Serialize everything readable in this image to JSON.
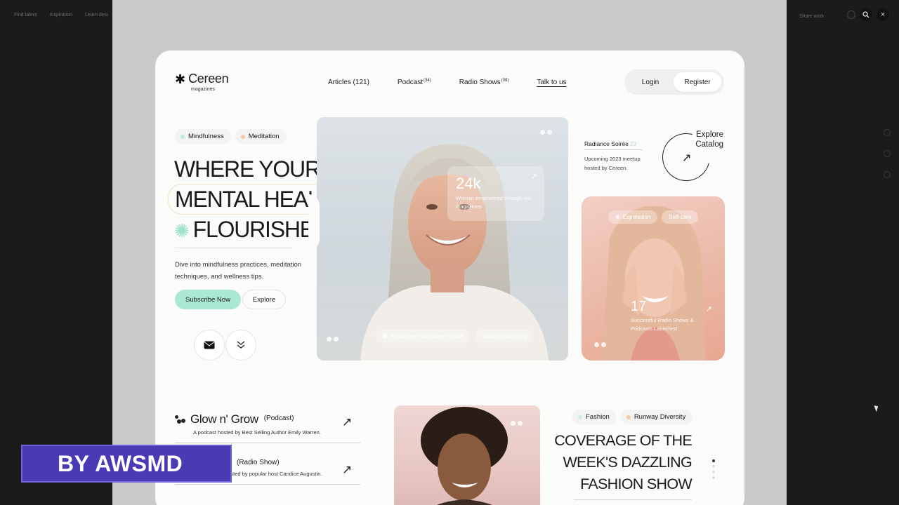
{
  "viewer": {
    "nav": [
      "Find talent",
      "Inspiration",
      "Learn desi"
    ],
    "share_label": "Share work",
    "zoom_icon": "search-icon",
    "close_glyph": "×"
  },
  "site": {
    "brand": "Cereen",
    "brand_sub": "magazines",
    "nav": {
      "articles": "Articles (121)",
      "podcast": "Podcast",
      "podcast_count": "(34)",
      "radio": "Radio Shows",
      "radio_count": "(09)",
      "talk": "Talk to us"
    },
    "login": "Login",
    "register": "Register"
  },
  "hero": {
    "tags": [
      {
        "label": "Mindfulness",
        "color": "#bfe9da"
      },
      {
        "label": "Meditation",
        "color": "#f4c9a9"
      }
    ],
    "headline": [
      "WHERE YOUR",
      "MENTAL HEALTH",
      "FLOURISHES"
    ],
    "description": "Dive into mindfulness practices, meditation techniques, and wellness tips.",
    "subscribe": "Subscribe Now",
    "explore": "Explore",
    "stat_value": "24k",
    "stat_caption": "Woman empowered through our magazines",
    "pills": [
      "Rediscover Your Inner Peace",
      "holistic well-being"
    ]
  },
  "event": {
    "title": "Radiance Soirée",
    "year": "23",
    "description": "Upcoming 2023 meetup hosted by Cereen.",
    "explore_catalog": "Explore Catalog"
  },
  "side_card": {
    "pills": [
      "Expression",
      "Self-care"
    ],
    "stat_value": "17",
    "stat_caption": "Successful Radio Shows & Podcasts Launched"
  },
  "shows": [
    {
      "title": "Glow n' Grow",
      "kind": "(Podcast)",
      "subtitle": "A podcast hosted by Best Selling Author Emily Warren."
    },
    {
      "title": "",
      "kind": "(Radio Show)",
      "subtitle": "A radio show hosted by popular host Candice Augustin."
    }
  ],
  "fashion": {
    "tags": [
      {
        "label": "Fashion",
        "color": "#cdeee2"
      },
      {
        "label": "Runway Diversity",
        "color": "#f4c9a9"
      }
    ],
    "headline": "COVERAGE OF THE WEEK'S DAZZLING FASHION SHOW"
  },
  "watermark": "BY AWSMD",
  "colors": {
    "accent_mint": "#abe8d3",
    "card_bg": "#fbfbfa",
    "watermark_bg": "#4a3bb5"
  }
}
